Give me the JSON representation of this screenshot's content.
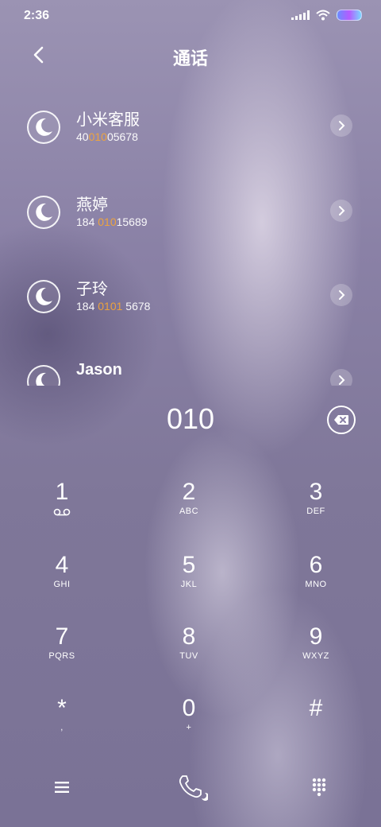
{
  "status_bar": {
    "time": "2:36"
  },
  "header": {
    "title": "通话"
  },
  "contacts": [
    {
      "name": "小米客服",
      "number_pre": "40",
      "number_hl": "010",
      "number_post": "05678"
    },
    {
      "name": "燕婷",
      "number_pre": "184 ",
      "number_hl": "010",
      "number_post": "15689"
    },
    {
      "name": "子玲",
      "number_pre": "184 ",
      "number_hl": "0101",
      "number_post": " 5678"
    },
    {
      "name": "Jason",
      "number_pre": "",
      "number_hl": "",
      "number_post": ""
    }
  ],
  "dial_input": {
    "value": "010"
  },
  "keypad": [
    {
      "digit": "1",
      "letters": ""
    },
    {
      "digit": "2",
      "letters": "ABC"
    },
    {
      "digit": "3",
      "letters": "DEF"
    },
    {
      "digit": "4",
      "letters": "GHI"
    },
    {
      "digit": "5",
      "letters": "JKL"
    },
    {
      "digit": "6",
      "letters": "MNO"
    },
    {
      "digit": "7",
      "letters": "PQRS"
    },
    {
      "digit": "8",
      "letters": "TUV"
    },
    {
      "digit": "9",
      "letters": "WXYZ"
    },
    {
      "digit": "*",
      "letters": ","
    },
    {
      "digit": "0",
      "letters": "+"
    },
    {
      "digit": "#",
      "letters": ""
    }
  ],
  "icons": {
    "back": "back-arrow-icon",
    "avatar": "moon-icon",
    "detail": "chevron-right-icon",
    "backspace": "backspace-icon",
    "voicemail": "voicemail-icon",
    "menu": "menu-icon",
    "call": "phone-icon",
    "dialpad": "dialpad-icon"
  },
  "colors": {
    "match_highlight": "#f2a53a"
  }
}
